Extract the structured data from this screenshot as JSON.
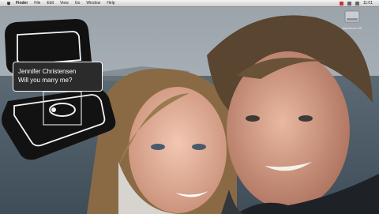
{
  "menubar": {
    "items": [
      "Finder",
      "File",
      "Edit",
      "View",
      "Go",
      "Window",
      "Help"
    ],
    "clock": "11:01"
  },
  "desktop": {
    "disk_label": "Macintosh HD"
  },
  "proposal": {
    "line1": "Jennifer Christensen",
    "line2": "Will you marry me?"
  },
  "colors": {
    "sky": "#b5bdc4",
    "sea": "#4a5a66",
    "box_fill": "#1c1c1c",
    "box_stroke": "#f4f4f4"
  }
}
